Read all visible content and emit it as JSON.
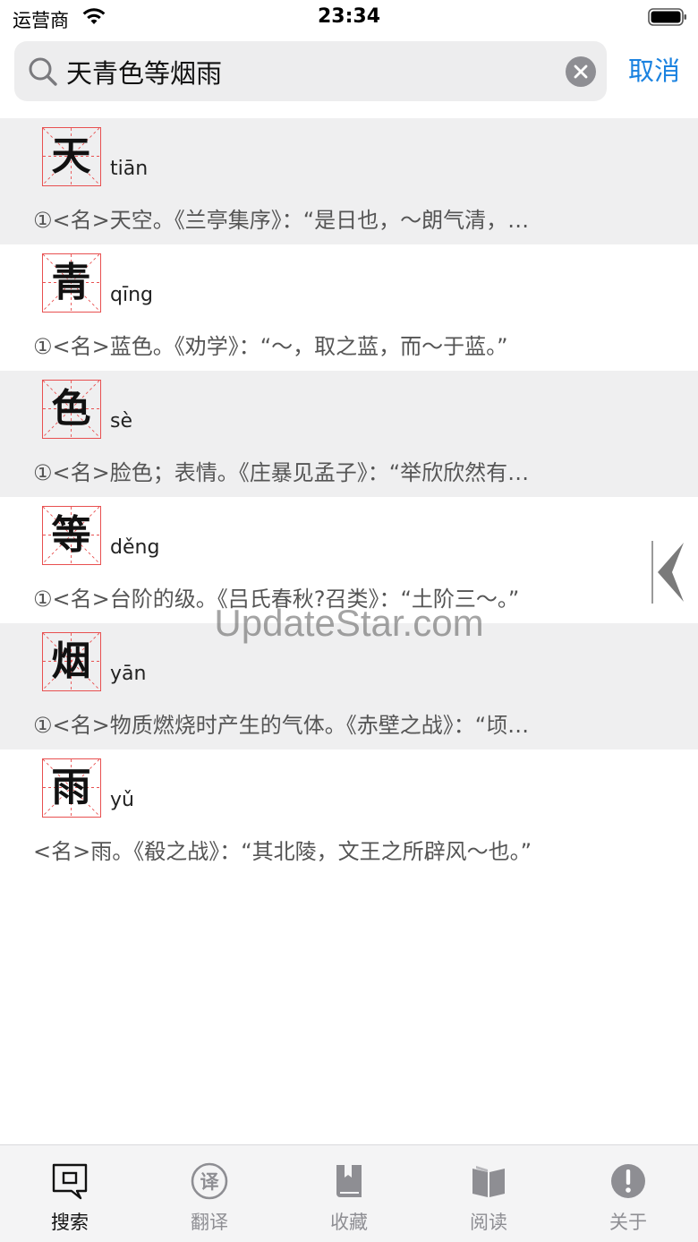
{
  "status_bar": {
    "carrier": "运营商",
    "time": "23:34"
  },
  "search": {
    "value": "天青色等烟雨",
    "cancel_label": "取消"
  },
  "results": [
    {
      "char": "天",
      "pinyin": "tiān",
      "definition": "①<名>天空。《兰亭集序》：“是日也，～朗气清，…"
    },
    {
      "char": "青",
      "pinyin": "qīng",
      "definition": "①<名>蓝色。《劝学》：“～，取之蓝，而～于蓝。”"
    },
    {
      "char": "色",
      "pinyin": "sè",
      "definition": "①<名>脸色；表情。《庄暴见孟子》：“举欣欣然有…"
    },
    {
      "char": "等",
      "pinyin": "děng",
      "definition": "①<名>台阶的级。《吕氏春秋?召类》：“土阶三～。”"
    },
    {
      "char": "烟",
      "pinyin": "yān",
      "definition": "①<名>物质燃烧时产生的气体。《赤壁之战》：“顷…"
    },
    {
      "char": "雨",
      "pinyin": "yǔ",
      "definition": "<名>雨。《殽之战》：“其北陵，文王之所辟风～也。”"
    }
  ],
  "watermark": "UpdateStar.com",
  "tab_bar": {
    "tabs": [
      {
        "label": "搜索",
        "icon": "search-tab-icon",
        "active": true
      },
      {
        "label": "翻译",
        "icon": "translate-tab-icon",
        "active": false
      },
      {
        "label": "收藏",
        "icon": "bookmark-book-icon",
        "active": false
      },
      {
        "label": "阅读",
        "icon": "open-book-icon",
        "active": false
      },
      {
        "label": "关于",
        "icon": "info-icon",
        "active": false
      }
    ]
  },
  "colors": {
    "accent": "#1a82e0",
    "grid_red": "#e85050",
    "row_shade": "#efeff0",
    "tab_inactive": "#8e8e93"
  }
}
